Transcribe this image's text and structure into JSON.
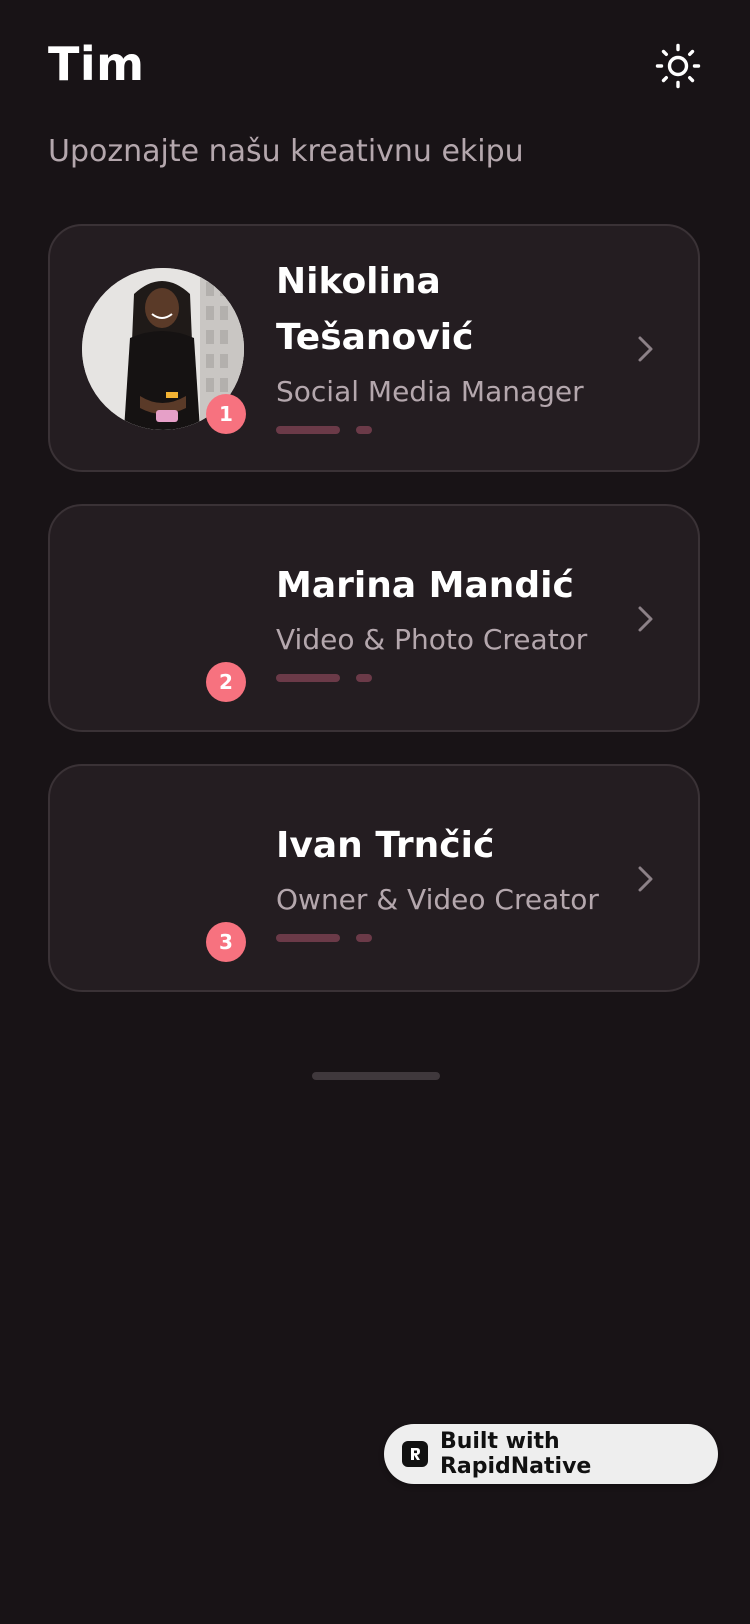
{
  "header": {
    "title": "Tim",
    "theme_icon": "sun-icon"
  },
  "subtitle": "Upoznajte našu kreativnu ekipu",
  "team": [
    {
      "rank": "1",
      "name": "Nikolina Tešanović",
      "role": "Social Media Manager",
      "has_photo": true
    },
    {
      "rank": "2",
      "name": "Marina Mandić",
      "role": "Video & Photo Creator",
      "has_photo": false
    },
    {
      "rank": "3",
      "name": "Ivan Trnčić",
      "role": "Owner & Video Creator",
      "has_photo": false
    }
  ],
  "footer": {
    "built_with": "Built with RapidNative"
  },
  "colors": {
    "background": "#181316",
    "card": "#241d21",
    "card_border": "#3a3236",
    "accent": "#f7727f",
    "muted_text": "#b4a7ad",
    "progress": "#6b3a48"
  }
}
